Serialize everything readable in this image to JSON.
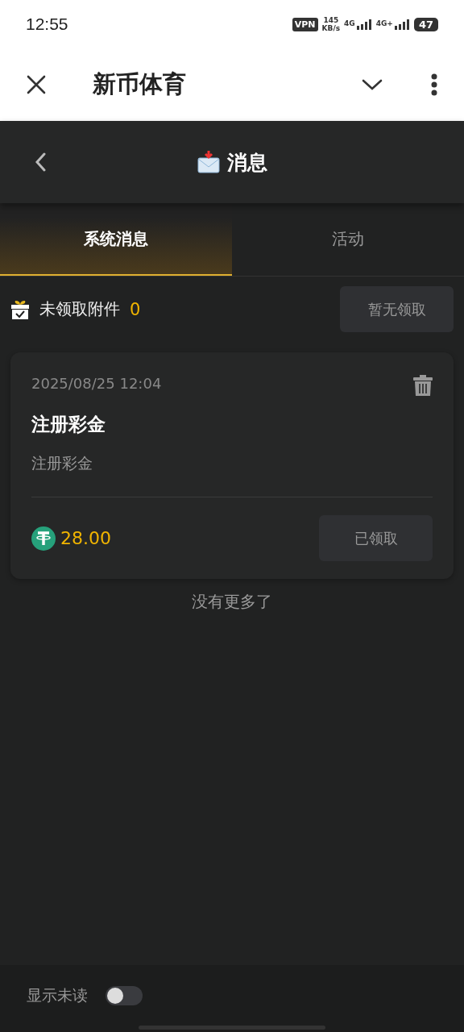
{
  "status_bar": {
    "time": "12:55",
    "vpn": "VPN",
    "speed": "145",
    "speed_unit": "KB/s",
    "network_1": "4G",
    "network_2": "4G+",
    "battery": "47"
  },
  "app_bar": {
    "title": "新币体育"
  },
  "header": {
    "title": "消息"
  },
  "tabs": [
    {
      "label": "系统消息",
      "selected": true
    },
    {
      "label": "活动",
      "selected": false
    }
  ],
  "claim_bar": {
    "label": "未领取附件",
    "count": "0",
    "button": "暂无领取"
  },
  "messages": [
    {
      "time": "2025/08/25 12:04",
      "title": "注册彩金",
      "body": "注册彩金",
      "amount": "28.00",
      "button": "已领取",
      "claimed": true
    }
  ],
  "end_note": "没有更多了",
  "footer": {
    "label": "显示未读",
    "on": false
  }
}
